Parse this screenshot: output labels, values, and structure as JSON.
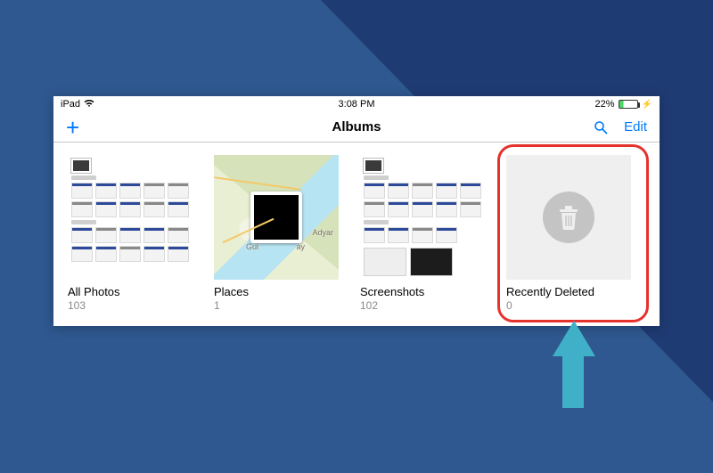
{
  "status": {
    "device": "iPad",
    "time": "3:08 PM",
    "battery_pct": "22%"
  },
  "navbar": {
    "title": "Albums",
    "edit_label": "Edit"
  },
  "albums": [
    {
      "name": "All Photos",
      "count": "103"
    },
    {
      "name": "Places",
      "count": "1"
    },
    {
      "name": "Screenshots",
      "count": "102"
    },
    {
      "name": "Recently Deleted",
      "count": "0"
    }
  ],
  "map_labels": {
    "a": "Gui",
    "b": "ay",
    "c": "Adyar"
  },
  "highlight_target_index": 3
}
